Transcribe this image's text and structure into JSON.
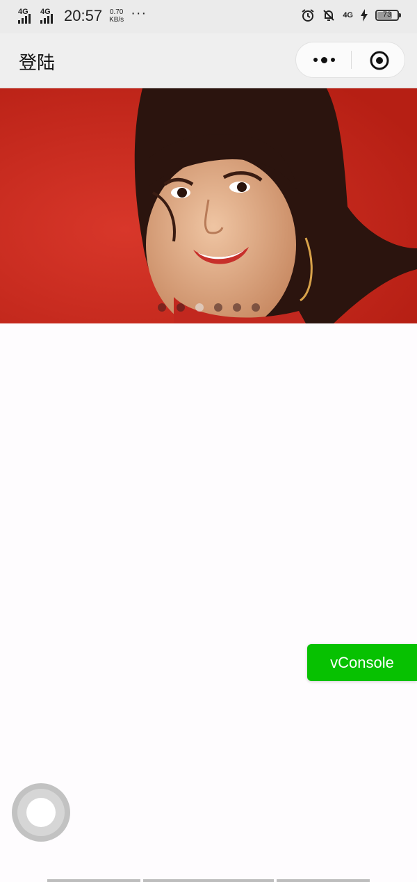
{
  "status_bar": {
    "signal_1": "4G",
    "signal_2": "4G",
    "time": "20:57",
    "speed_value": "0.70",
    "speed_unit": "KB/s",
    "more_dots": "···",
    "net_label": "4G",
    "battery": "73",
    "icons": [
      "alarm-icon",
      "dnd-bell-icon",
      "charging-bolt-icon",
      "battery-icon"
    ]
  },
  "navbar": {
    "title": "登陆",
    "more_icon": "more-dots-icon",
    "close_icon": "target-close-icon"
  },
  "banner": {
    "slide_count": 6,
    "active_index": 2,
    "image": "woman-red-background-photo"
  },
  "vconsole": {
    "label": "vConsole",
    "color": "#07c101"
  },
  "colors": {
    "status_bg": "#ebebeb",
    "nav_bg": "#efefef",
    "banner_red": "#c92a1e",
    "page_bg": "#fefcfe"
  }
}
